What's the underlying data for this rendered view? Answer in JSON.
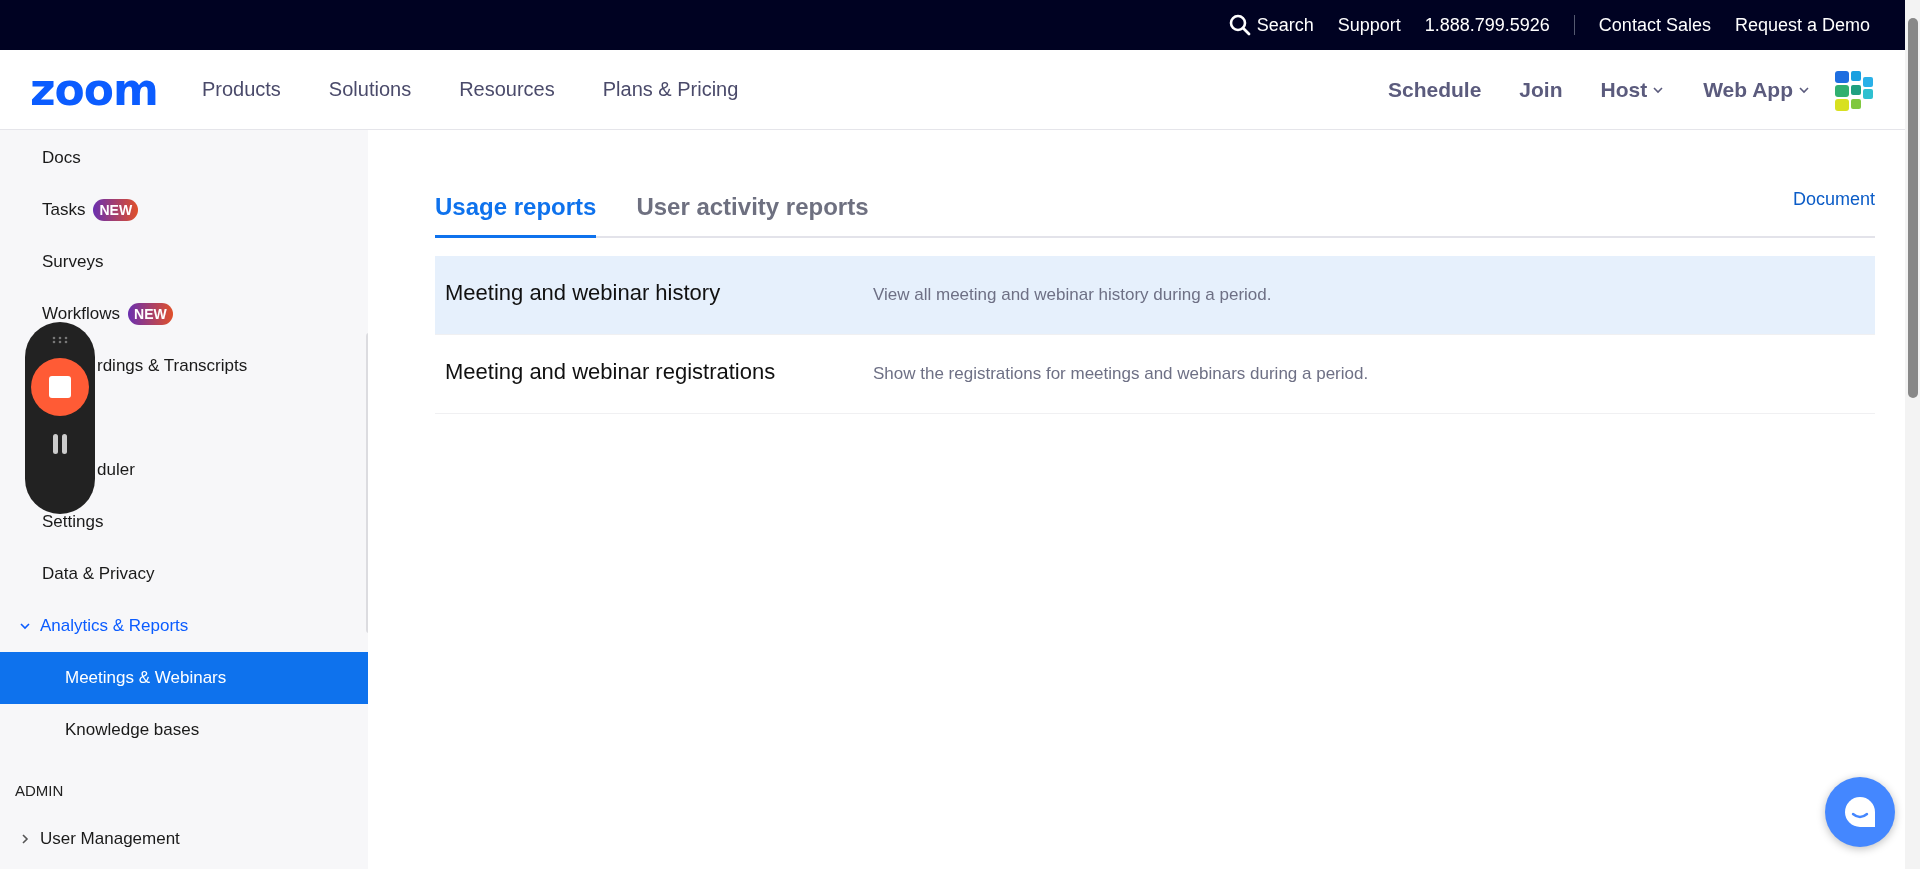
{
  "top_bar": {
    "search": "Search",
    "links": [
      "Support",
      "1.888.799.5926"
    ],
    "links_after_divider": [
      "Contact Sales",
      "Request a Demo"
    ]
  },
  "nav": {
    "logo": "zoom",
    "menu": [
      "Products",
      "Solutions",
      "Resources",
      "Plans & Pricing"
    ],
    "actions": [
      {
        "label": "Schedule",
        "dropdown": false
      },
      {
        "label": "Join",
        "dropdown": false
      },
      {
        "label": "Host",
        "dropdown": true
      },
      {
        "label": "Web App",
        "dropdown": true
      }
    ]
  },
  "sidebar": {
    "items": [
      {
        "kind": "link",
        "label": "Docs",
        "selected": false
      },
      {
        "kind": "link",
        "label": "Tasks",
        "badge": "NEW",
        "selected": false
      },
      {
        "kind": "link",
        "label": "Surveys",
        "selected": false
      },
      {
        "kind": "link",
        "label": "Workflows",
        "badge": "NEW",
        "selected": false
      },
      {
        "kind": "link",
        "label": "rdings & Transcripts",
        "selected": false
      },
      {
        "kind": "covered"
      },
      {
        "kind": "link",
        "label": "duler",
        "selected": false
      },
      {
        "kind": "link",
        "label": "Settings",
        "selected": false
      },
      {
        "kind": "link",
        "label": "Data & Privacy",
        "selected": false
      },
      {
        "kind": "group",
        "label": "Analytics & Reports",
        "expanded": true,
        "children": [
          {
            "label": "Meetings & Webinars",
            "selected": true
          },
          {
            "label": "Knowledge bases",
            "selected": false
          }
        ]
      },
      {
        "kind": "heading",
        "label": "ADMIN"
      },
      {
        "kind": "group",
        "label": "User Management",
        "expanded": false
      }
    ]
  },
  "tabs": [
    {
      "label": "Usage reports",
      "selected": true
    },
    {
      "label": "User activity reports",
      "selected": false
    }
  ],
  "document_link": "Document",
  "reports": [
    {
      "title": "Meeting and webinar history",
      "description": "View all meeting and webinar history during a period.",
      "selected": true
    },
    {
      "title": "Meeting and webinar registrations",
      "description": "Show the registrations for meetings and webinars during a period.",
      "selected": false
    }
  ]
}
